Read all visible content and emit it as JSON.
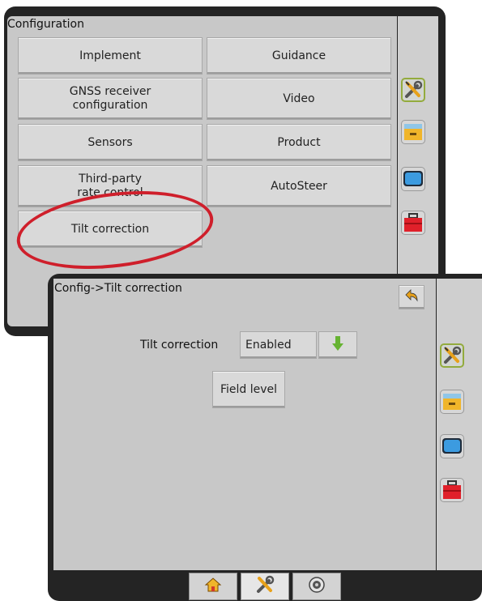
{
  "config_screen": {
    "title": "Configuration",
    "buttons": {
      "implement": "Implement",
      "guidance": "Guidance",
      "gnss_line1": "GNSS receiver",
      "gnss_line2": "configuration",
      "video": "Video",
      "sensors": "Sensors",
      "product": "Product",
      "third_party_line1": "Third-party",
      "third_party_line2": "rate control",
      "autosteer": "AutoSteer",
      "tilt_correction": "Tilt correction"
    },
    "side_icons": [
      "wrench-screwdriver-icon",
      "file-drawer-icon",
      "screen-icon",
      "toolbox-icon"
    ],
    "highlight_color": "#cf1f2b"
  },
  "tilt_screen": {
    "title": "Config->Tilt correction",
    "tilt_label": "Tilt correction",
    "tilt_value": "Enabled",
    "field_level_label": "Field level",
    "back_icon": "back-arrow-icon",
    "bottom_tabs": [
      "home-icon",
      "wrench-screwdriver-icon",
      "camera-icon"
    ],
    "active_tab": 1
  },
  "colors": {
    "frame": "#242424",
    "content_bg": "#c8c8c8",
    "button_bg": "#d9d9d9",
    "accent_green": "#93ab3d",
    "back_button": "#e8a11a"
  }
}
